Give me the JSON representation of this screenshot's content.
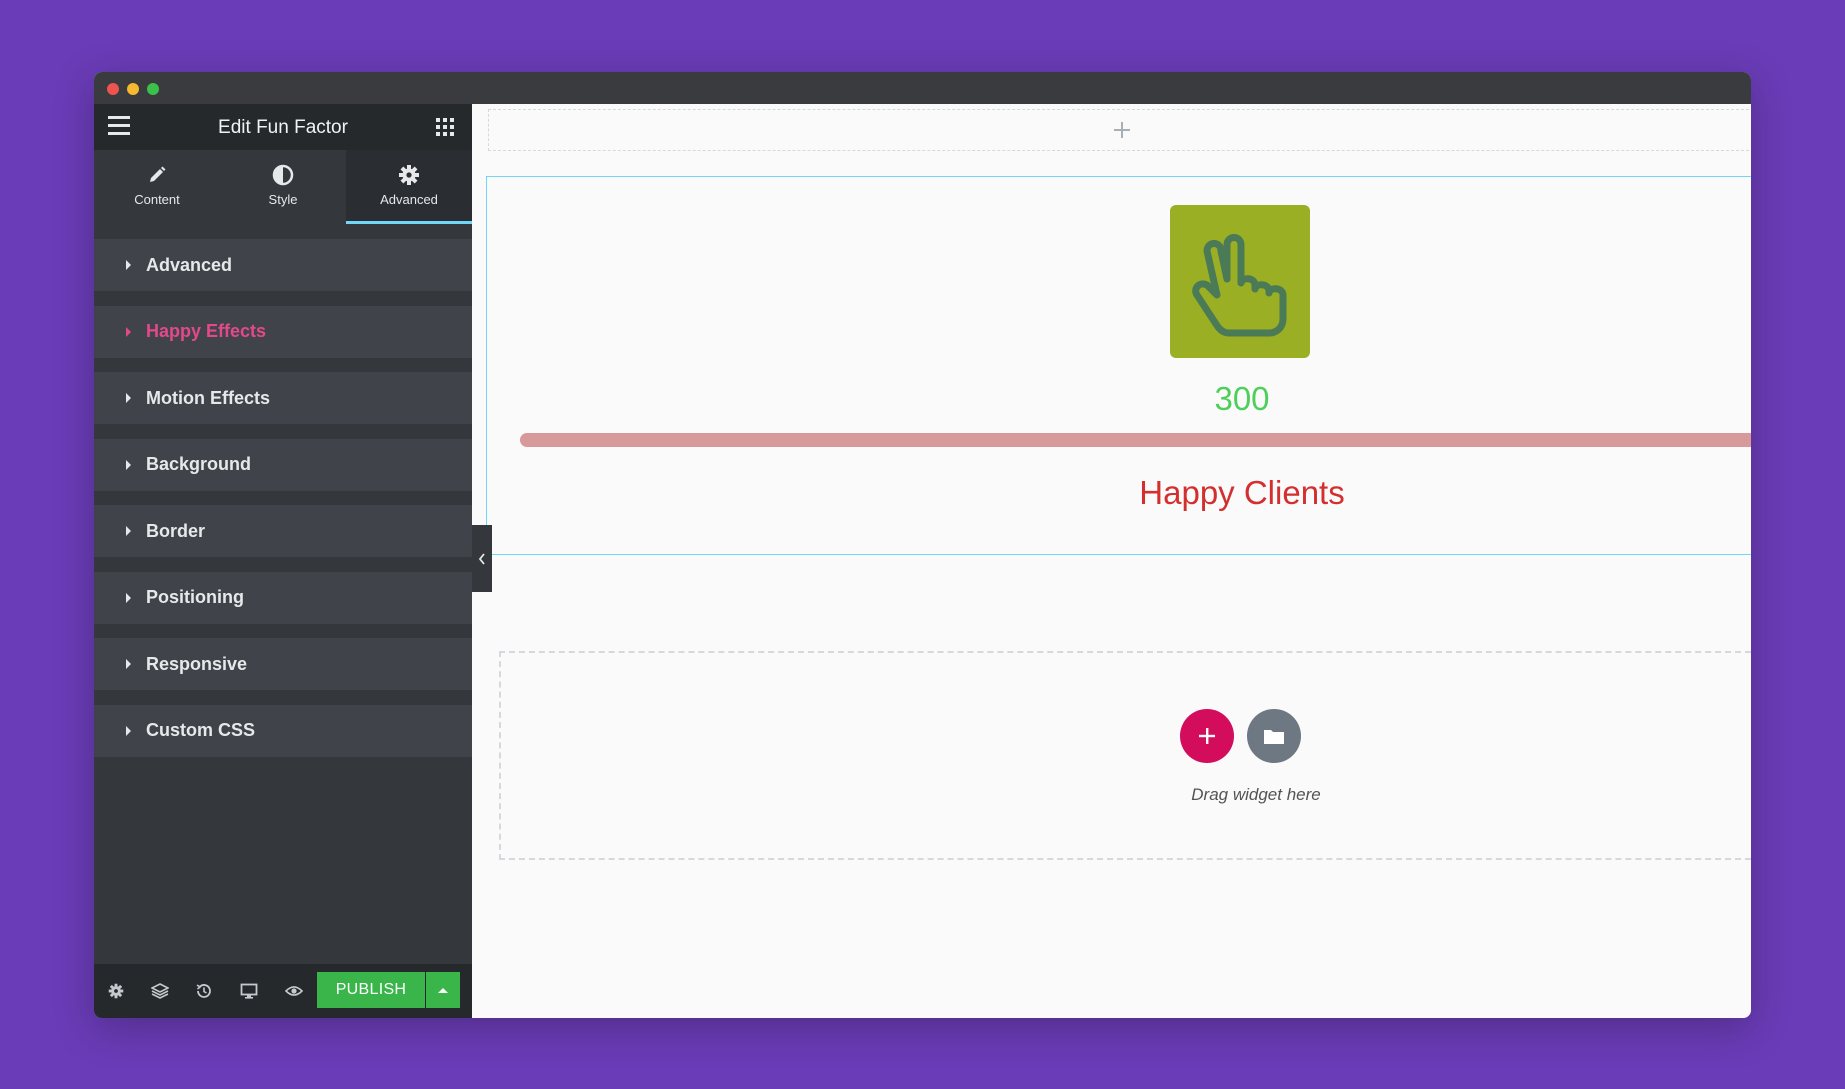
{
  "panel": {
    "title": "Edit Fun Factor",
    "tabs": [
      {
        "label": "Content",
        "icon": "pencil-icon"
      },
      {
        "label": "Style",
        "icon": "half-circle-icon"
      },
      {
        "label": "Advanced",
        "icon": "gear-icon",
        "active": true
      }
    ],
    "sections": [
      {
        "label": "Advanced"
      },
      {
        "label": "Happy Effects",
        "highlight": true
      },
      {
        "label": "Motion Effects"
      },
      {
        "label": "Background"
      },
      {
        "label": "Border"
      },
      {
        "label": "Positioning"
      },
      {
        "label": "Responsive"
      },
      {
        "label": "Custom CSS"
      }
    ],
    "footer": {
      "publish_label": "PUBLISH",
      "icons": [
        "settings-icon",
        "layers-icon",
        "history-icon",
        "responsive-icon",
        "preview-icon"
      ]
    }
  },
  "canvas": {
    "fun_factor": {
      "number": "300",
      "title": "Happy Clients",
      "icon": "peace-hand-icon",
      "icon_bg": "#9aaf23",
      "number_color": "#4fcf5a",
      "title_color": "#d32f2f",
      "bar_color": "#d8999a"
    },
    "dropzone": {
      "text": "Drag widget here"
    }
  },
  "colors": {
    "page_bg": "#6a3cb7",
    "panel_bg": "#34383c",
    "accent_tab": "#71d7f7",
    "publish_green": "#39b54a",
    "happy_pink": "#e2498a",
    "add_button": "#d30c5c"
  }
}
